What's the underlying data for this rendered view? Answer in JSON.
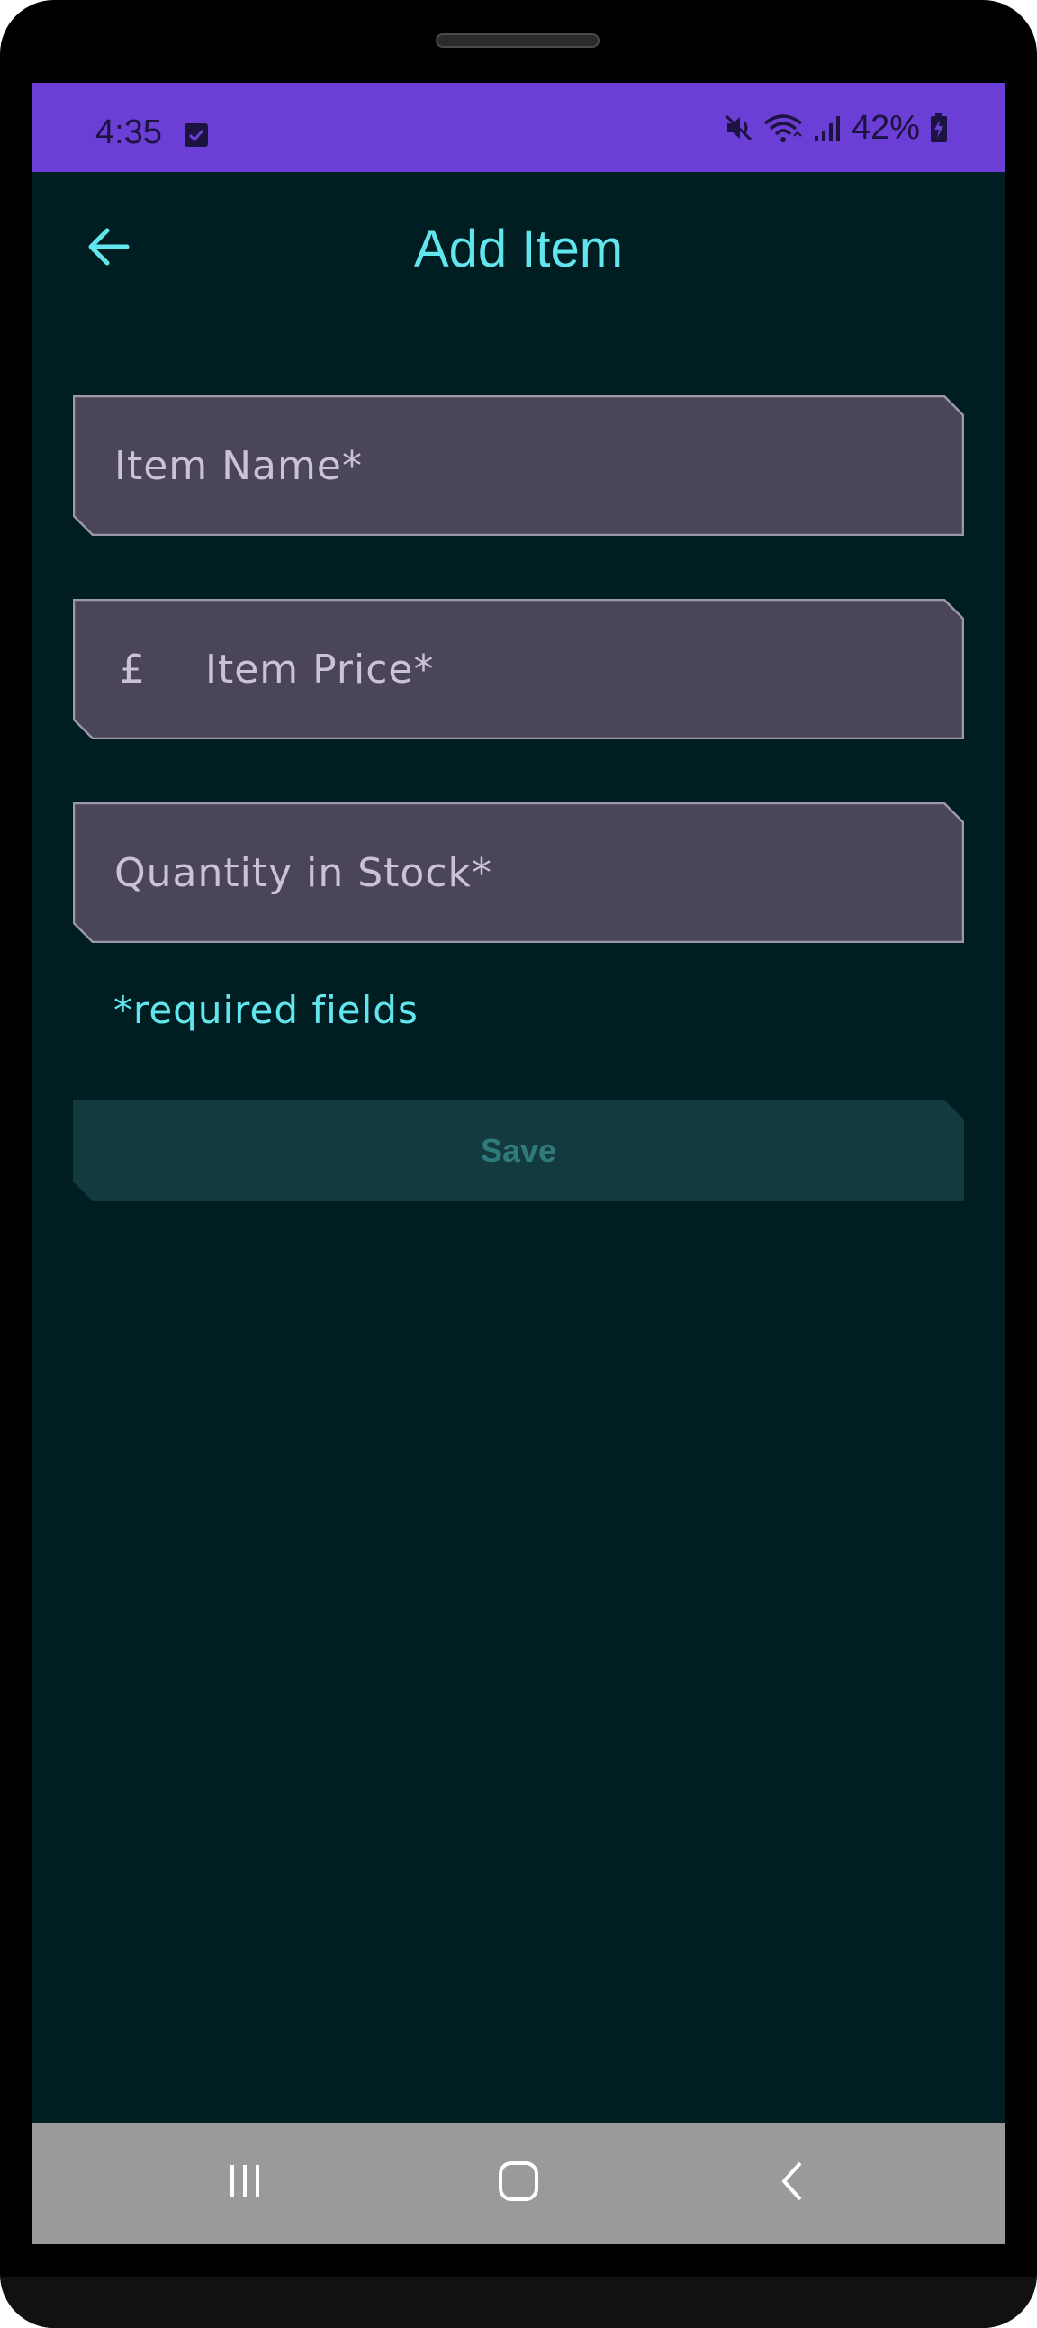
{
  "status_bar": {
    "time": "4:35",
    "battery": "42%",
    "icons": [
      "task-check-icon",
      "mute-icon",
      "wifi-icon",
      "signal-icon",
      "battery-charging-icon"
    ]
  },
  "app_bar": {
    "title": "Add Item",
    "back_icon": "arrow-left-icon"
  },
  "form": {
    "item_name_placeholder": "Item Name*",
    "currency_symbol": "£",
    "item_price_placeholder": "Item Price*",
    "quantity_placeholder": "Quantity in Stock*",
    "required_note": "*required fields",
    "save_label": "Save"
  },
  "nav_bar": {
    "icons": [
      "recent-apps-icon",
      "home-icon",
      "back-icon"
    ]
  },
  "colors": {
    "screen_bg": "#001e21",
    "status_bar_bg": "#6b3fd6",
    "accent": "#62e6ee",
    "field_bg": "#4a4559",
    "field_border": "#9b98a8",
    "button_bg": "#133a3f",
    "button_text": "#2f7a7c",
    "nav_bar_bg": "#9a9a9a"
  }
}
